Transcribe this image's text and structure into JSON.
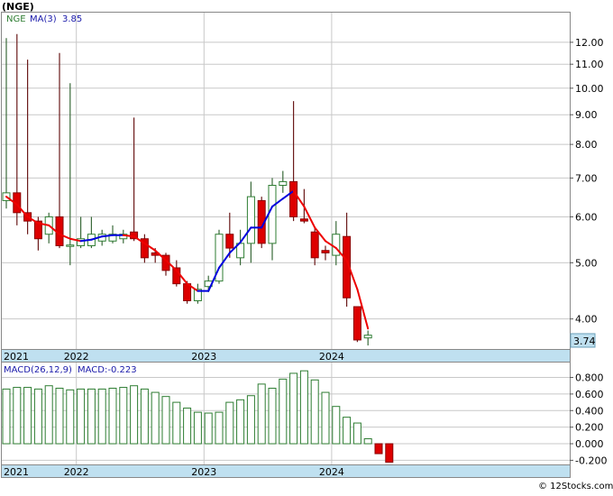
{
  "title": "(NGE)",
  "ticker_label": "NGE",
  "ma_label": "MA(3)",
  "ma_value": "3.85",
  "last_price": "3.74",
  "macd_label": "MACD(26,12,9)",
  "macd_value_label": "MACD:-0.223",
  "watermark": "© 12Stocks.com",
  "colors": {
    "up": "#2e7d32",
    "down": "#dd0000",
    "ma_up": "#0000dd",
    "ma_down": "#ee0000",
    "axis_band": "#bfe0f0",
    "grid": "#c8c8c8",
    "text_blue": "#1a1aaa"
  },
  "chart_data": [
    {
      "type": "candlestick",
      "title": "(NGE)",
      "scale": "log",
      "ylim": [
        3.55,
        13.5
      ],
      "grid": true,
      "x_ticks": [
        {
          "label": "2021",
          "i": 0
        },
        {
          "label": "2022",
          "i": 7
        },
        {
          "label": "2023",
          "i": 19
        },
        {
          "label": "2024",
          "i": 31
        }
      ],
      "y_ticks": [
        "4.00",
        "5.00",
        "6.00",
        "7.00",
        "8.00",
        "9.00",
        "10.00",
        "11.00",
        "12.00"
      ],
      "candles": [
        {
          "o": 6.4,
          "h": 12.2,
          "l": 6.2,
          "c": 6.6
        },
        {
          "o": 6.6,
          "h": 12.4,
          "l": 5.8,
          "c": 6.1
        },
        {
          "o": 6.1,
          "h": 11.2,
          "l": 5.6,
          "c": 5.9
        },
        {
          "o": 5.9,
          "h": 6.0,
          "l": 5.25,
          "c": 5.5
        },
        {
          "o": 5.6,
          "h": 6.1,
          "l": 5.4,
          "c": 6.0
        },
        {
          "o": 6.0,
          "h": 11.5,
          "l": 5.3,
          "c": 5.35
        },
        {
          "o": 5.35,
          "h": 10.2,
          "l": 4.95,
          "c": 5.35
        },
        {
          "o": 5.35,
          "h": 6.0,
          "l": 5.3,
          "c": 5.5
        },
        {
          "o": 5.35,
          "h": 6.0,
          "l": 5.3,
          "c": 5.6
        },
        {
          "o": 5.45,
          "h": 5.7,
          "l": 5.35,
          "c": 5.6
        },
        {
          "o": 5.45,
          "h": 5.8,
          "l": 5.4,
          "c": 5.6
        },
        {
          "o": 5.5,
          "h": 5.7,
          "l": 5.4,
          "c": 5.6
        },
        {
          "o": 5.65,
          "h": 8.9,
          "l": 5.45,
          "c": 5.5
        },
        {
          "o": 5.5,
          "h": 5.6,
          "l": 5.0,
          "c": 5.1
        },
        {
          "o": 5.2,
          "h": 5.3,
          "l": 5.0,
          "c": 5.15
        },
        {
          "o": 5.15,
          "h": 5.2,
          "l": 4.75,
          "c": 4.85
        },
        {
          "o": 4.9,
          "h": 5.05,
          "l": 4.55,
          "c": 4.6
        },
        {
          "o": 4.6,
          "h": 4.65,
          "l": 4.25,
          "c": 4.3
        },
        {
          "o": 4.3,
          "h": 4.6,
          "l": 4.25,
          "c": 4.5
        },
        {
          "o": 4.55,
          "h": 4.75,
          "l": 4.45,
          "c": 4.65
        },
        {
          "o": 4.65,
          "h": 5.7,
          "l": 4.6,
          "c": 5.6
        },
        {
          "o": 5.6,
          "h": 6.1,
          "l": 5.1,
          "c": 5.3
        },
        {
          "o": 5.1,
          "h": 5.7,
          "l": 4.95,
          "c": 5.4
        },
        {
          "o": 5.4,
          "h": 6.9,
          "l": 5.0,
          "c": 6.5
        },
        {
          "o": 6.4,
          "h": 6.5,
          "l": 5.3,
          "c": 5.4
        },
        {
          "o": 5.4,
          "h": 7.0,
          "l": 5.05,
          "c": 6.8
        },
        {
          "o": 6.8,
          "h": 7.2,
          "l": 6.6,
          "c": 6.9
        },
        {
          "o": 6.9,
          "h": 9.5,
          "l": 5.9,
          "c": 6.0
        },
        {
          "o": 5.95,
          "h": 6.7,
          "l": 5.85,
          "c": 5.9
        },
        {
          "o": 5.65,
          "h": 5.75,
          "l": 4.95,
          "c": 5.1
        },
        {
          "o": 5.25,
          "h": 5.35,
          "l": 5.05,
          "c": 5.2
        },
        {
          "o": 5.15,
          "h": 5.9,
          "l": 4.95,
          "c": 5.6
        },
        {
          "o": 5.55,
          "h": 6.1,
          "l": 4.2,
          "c": 4.35
        },
        {
          "o": 4.2,
          "h": 4.2,
          "l": 3.65,
          "c": 3.68
        },
        {
          "o": 3.72,
          "h": 3.82,
          "l": 3.6,
          "c": 3.74
        }
      ],
      "ma": [
        6.5,
        6.3,
        6.0,
        5.85,
        5.8,
        5.6,
        5.5,
        5.45,
        5.48,
        5.55,
        5.58,
        5.58,
        5.55,
        5.4,
        5.25,
        5.05,
        4.85,
        4.6,
        4.47,
        4.47,
        4.9,
        5.2,
        5.42,
        5.75,
        5.75,
        6.25,
        6.45,
        6.65,
        6.25,
        5.75,
        5.45,
        5.3,
        5.05,
        4.5,
        3.85
      ]
    },
    {
      "type": "bar",
      "title": "MACD(26,12,9)",
      "ylim": [
        -0.25,
        0.98
      ],
      "grid": true,
      "y_ticks": [
        "0.800",
        "0.600",
        "0.400",
        "0.200",
        "0.000",
        "-0.200"
      ],
      "values": [
        0.66,
        0.68,
        0.68,
        0.66,
        0.7,
        0.67,
        0.65,
        0.66,
        0.66,
        0.66,
        0.67,
        0.68,
        0.7,
        0.66,
        0.62,
        0.57,
        0.5,
        0.43,
        0.38,
        0.37,
        0.38,
        0.5,
        0.53,
        0.58,
        0.72,
        0.67,
        0.78,
        0.85,
        0.88,
        0.77,
        0.62,
        0.45,
        0.32,
        0.25,
        0.06,
        -0.12,
        -0.223
      ]
    }
  ]
}
